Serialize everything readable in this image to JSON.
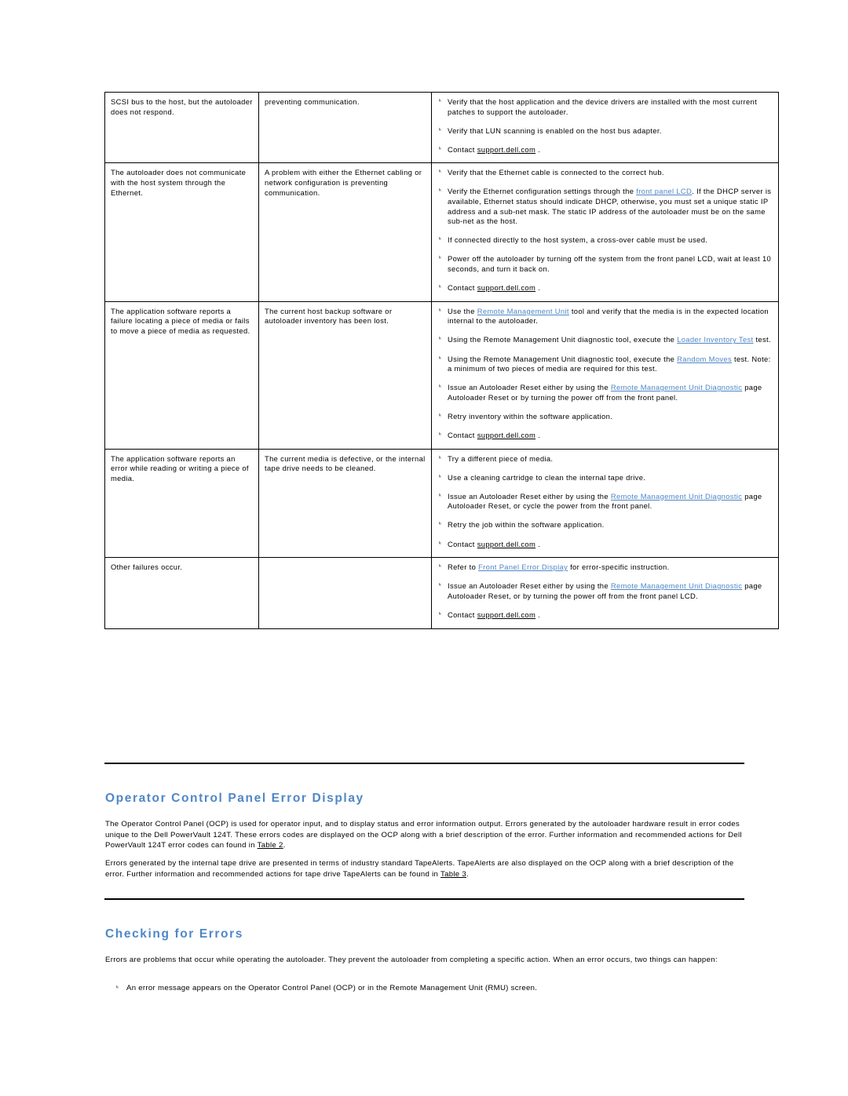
{
  "table": {
    "rows": [
      {
        "col1": "SCSI bus to the host, but the autoloader does not respond.",
        "col2": "preventing communication.",
        "col3": [
          "Verify that the host application and the device drivers are installed with the most current patches to support the autoloader.",
          "Verify that LUN scanning is enabled on the host bus adapter.",
          "Contact support.dell.com ."
        ]
      },
      {
        "col1": "The autoloader does not communicate with the host system through the Ethernet.",
        "col2": "A problem with either the Ethernet cabling or network configuration is preventing communication.",
        "col3": [
          "Verify that the Ethernet cable is connected to the correct hub.",
          "Verify the Ethernet configuration settings through the front panel LCD. If the DHCP server is available, Ethernet status should indicate DHCP, otherwise, you must set a unique static IP address and a sub-net mask. The static IP address of the autoloader must be on the same sub-net as the host.",
          "If connected directly to the host system, a cross-over cable must be used.",
          "Power off the autoloader by turning off the system from the front panel LCD, wait at least 10 seconds, and turn it back on.",
          "Contact support.dell.com ."
        ]
      },
      {
        "col1": "The application software reports a failure locating a piece of media or fails to move a piece of media as requested.",
        "col2": "The current host backup software or autoloader inventory has been lost.",
        "col3": [
          "Use the Remote Management Unit tool and verify that the media is in the expected location internal to the autoloader.",
          "Using the Remote Management Unit diagnostic tool, execute the Loader Inventory Test test.",
          "Using the Remote Management Unit diagnostic tool, execute the Random Moves test. Note: a minimum of two pieces of media are required for this test.",
          "Issue an Autoloader Reset either by using the Remote Management Unit Diagnostic page Autoloader Reset or by turning the power off from the front panel.",
          "Retry inventory within the software application.",
          "Contact support.dell.com ."
        ]
      },
      {
        "col1": "The application software reports an error while reading or writing a piece of media.",
        "col2": "The current media is defective, or the internal tape drive needs to be cleaned.",
        "col3": [
          "Try a different piece of media.",
          "Use a cleaning cartridge to clean the internal tape drive.",
          "Issue an Autoloader Reset either by using the Remote Management Unit Diagnostic page Autoloader Reset, or cycle the power from the front panel.",
          "Retry the job within the software application.",
          "Contact support.dell.com ."
        ]
      },
      {
        "col1": "Other failures occur.",
        "col2": "",
        "col3": [
          "Refer to Front Panel Error Display for error-specific instruction.",
          "Issue an Autoloader Reset either by using the Remote Management Unit Diagnostic page Autoloader Reset, or by turning the power off from the front panel LCD.",
          "Contact support.dell.com ."
        ]
      }
    ],
    "links": {
      "support": "support.dell.com",
      "front_panel_lcd": "front panel LCD",
      "remote_management_unit": "Remote Management Unit",
      "loader_inventory_test": "Loader Inventory Test",
      "random_moves": "Random Moves",
      "rmu_diagnostic": "Remote Management Unit Diagnostic",
      "front_panel_error_display": "Front Panel Error Display"
    }
  },
  "sections": [
    {
      "heading": "Operator Control Panel Error Display",
      "paragraphs": [
        "The Operator Control Panel (OCP) is used for operator input, and to display status and error information output. Errors generated by the autoloader hardware result in error codes unique to the Dell PowerVault 124T. These errors codes are displayed on the OCP along with a brief description of the error. Further information and recommended actions for Dell PowerVault 124T error codes can found in Table 2.",
        "Errors generated by the internal tape drive are presented in terms of industry standard TapeAlerts. TapeAlerts are also displayed on the OCP along with a brief description of the error. Further information and recommended actions for tape drive TapeAlerts can be found in Table 3."
      ],
      "inline_links": [
        "Table 2",
        "Table 3"
      ]
    },
    {
      "heading": "Checking for Errors",
      "paragraphs": [
        "Errors are problems that occur while operating the autoloader. They prevent the autoloader from completing a specific action. When an error occurs, two things can happen:"
      ],
      "bullets": [
        "An error message appears on the Operator Control Panel (OCP) or in the Remote Management Unit (RMU) screen."
      ]
    }
  ],
  "colors": {
    "link": "#4f87c6",
    "heading": "#4f87c6",
    "text": "#000000",
    "border": "#000000"
  }
}
